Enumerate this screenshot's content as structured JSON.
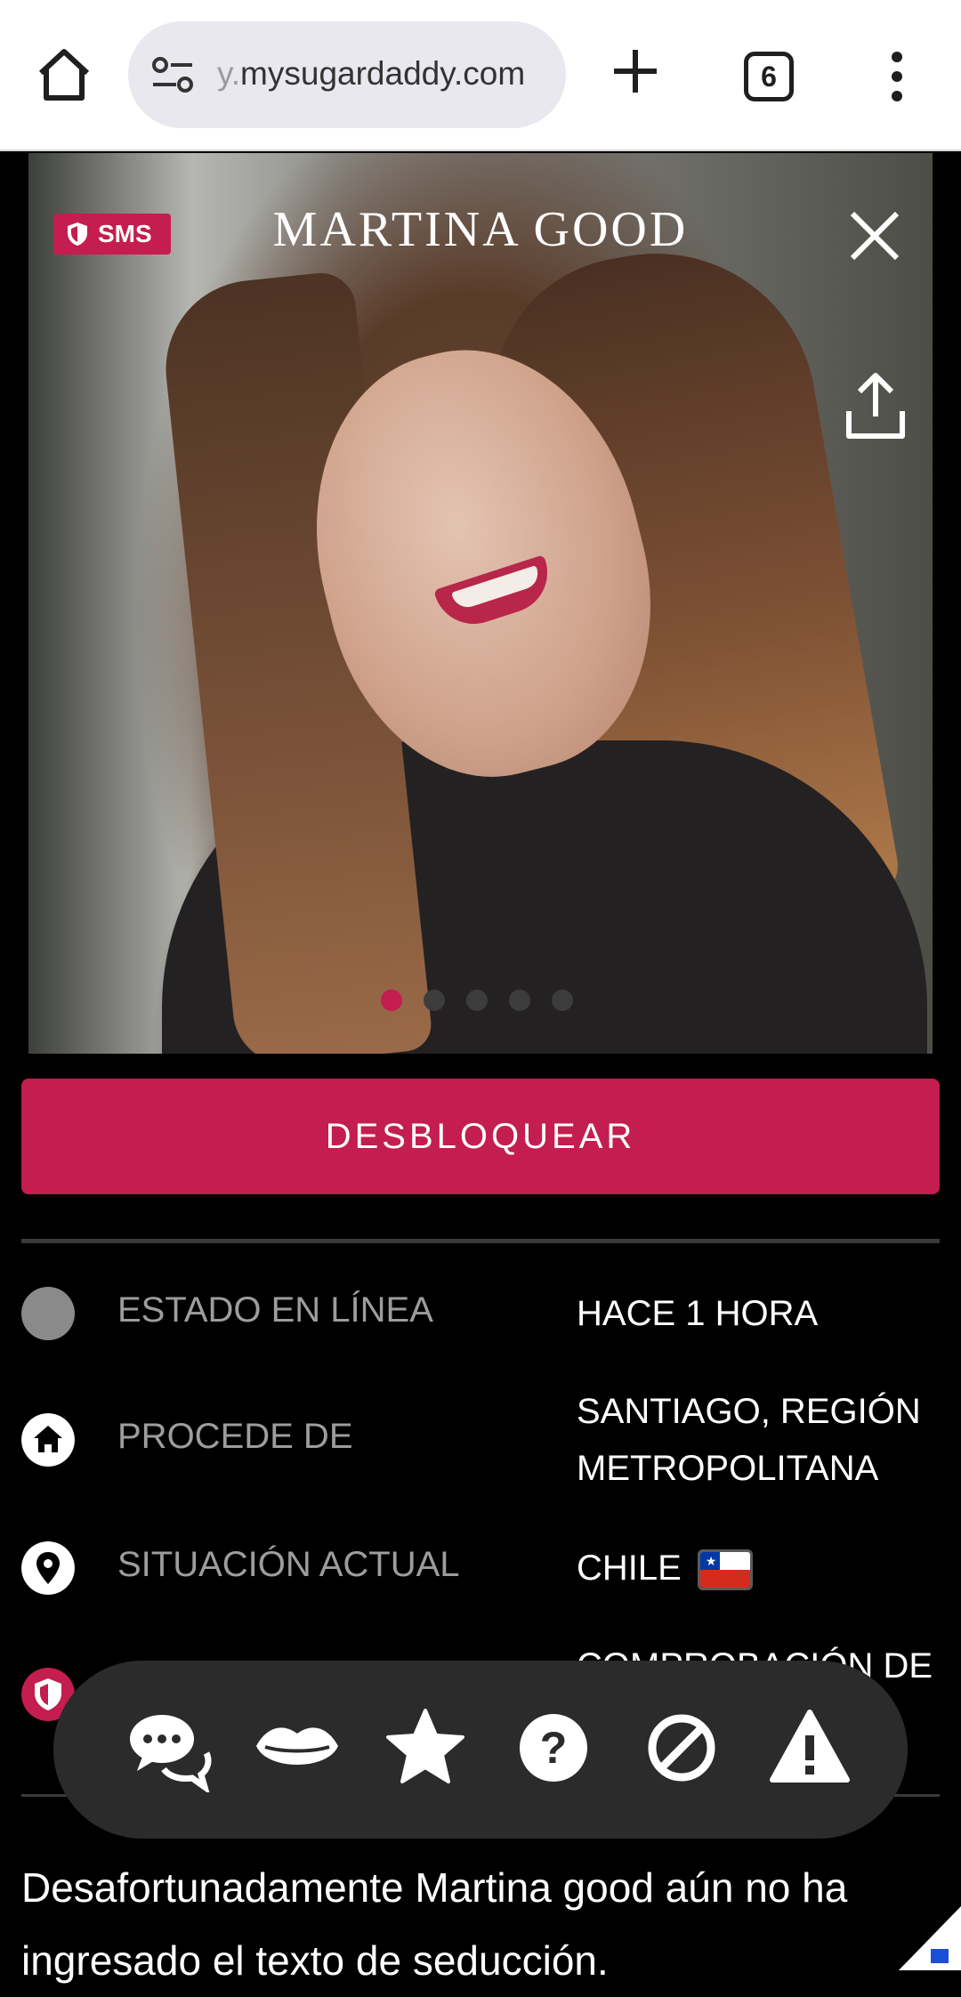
{
  "browser": {
    "url_fade": "y.",
    "url_main": "mysugardaddy.com",
    "tab_count": "6"
  },
  "profile": {
    "name": "MARTINA GOOD",
    "badge": "SMS",
    "photo_count": 5,
    "active_photo_index": 0
  },
  "unlock_label": "DESBLOQUEAR",
  "info_rows": [
    {
      "label": "ESTADO EN LÍNEA",
      "value": "HACE 1 HORA",
      "icon": "status-dot-icon"
    },
    {
      "label": "PROCEDE DE",
      "value": "SANTIAGO, REGIÓN METROPOLITANA",
      "icon": "home-icon"
    },
    {
      "label": "SITUACIÓN ACTUAL",
      "value": "CHILE",
      "icon": "location-pin-icon"
    },
    {
      "label": "",
      "value": "COMPROBACIÓN DE",
      "icon": "shield-icon"
    }
  ],
  "dock": [
    "chat-icon",
    "kiss-icon",
    "star-icon",
    "help-icon",
    "block-icon",
    "report-icon"
  ],
  "bio_text": "Desafortunadamente Martina good aún no ha ingresado el texto de seducción.",
  "colors": {
    "accent": "#c41d4f",
    "background": "#000000",
    "dock": "#2b2b2b"
  }
}
